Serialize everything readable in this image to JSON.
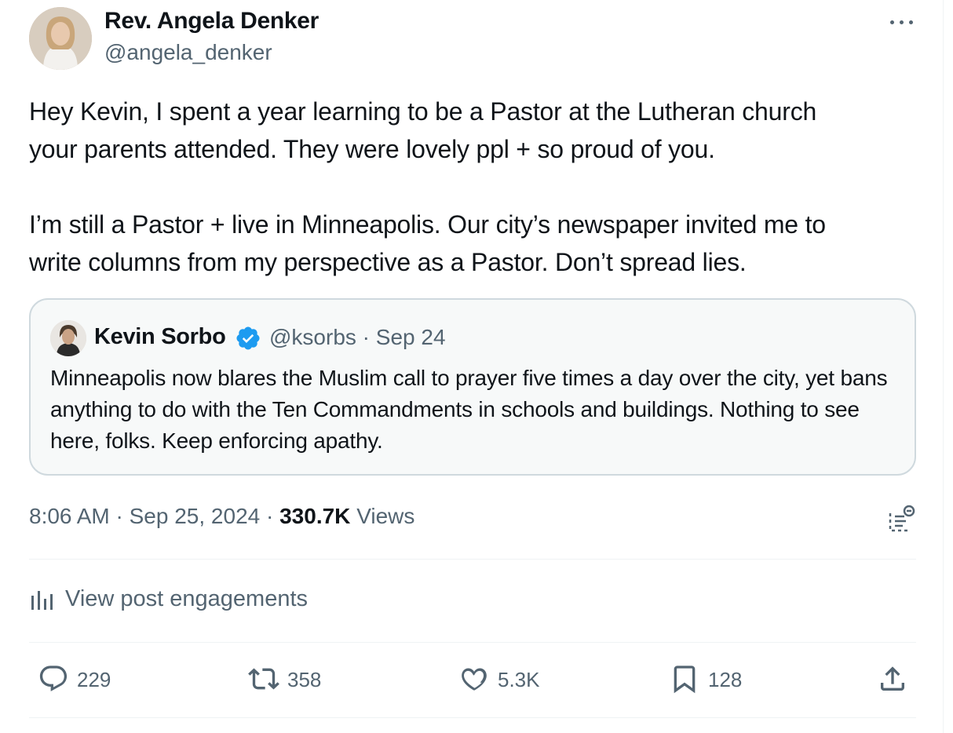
{
  "author": {
    "name": "Rev. Angela Denker",
    "handle": "@angela_denker"
  },
  "post": {
    "text": "Hey Kevin, I spent a year learning to be a Pastor at the Lutheran church\nyour parents attended. They were lovely ppl + so proud of you.\n\nI’m still a Pastor + live in Minneapolis. Our city’s newspaper invited me to\nwrite columns from my perspective as a Pastor. Don’t spread lies.",
    "time": "8:06 AM",
    "date": "Sep 25, 2024",
    "separator": " · ",
    "views_count": "330.7K",
    "views_label": "Views"
  },
  "quote": {
    "name": "Kevin Sorbo",
    "meta": "@ksorbs · Sep 24",
    "text": "Minneapolis now blares the Muslim call to prayer five times a day over the city, yet bans anything to do with the Ten Commandments in schools and buildings. Nothing to see here, folks.  Keep enforcing apathy."
  },
  "engagements_label": "View post engagements",
  "actions": {
    "replies": "229",
    "reposts": "358",
    "likes": "5.3K",
    "bookmarks": "128"
  },
  "colors": {
    "verified": "#1d9bf0",
    "secondary_text": "#536471",
    "border": "#cfd9de"
  },
  "icons": [
    "more-icon",
    "verified-badge-icon",
    "grok-icon",
    "analytics-icon",
    "reply-icon",
    "repost-icon",
    "like-icon",
    "bookmark-icon",
    "share-icon"
  ]
}
